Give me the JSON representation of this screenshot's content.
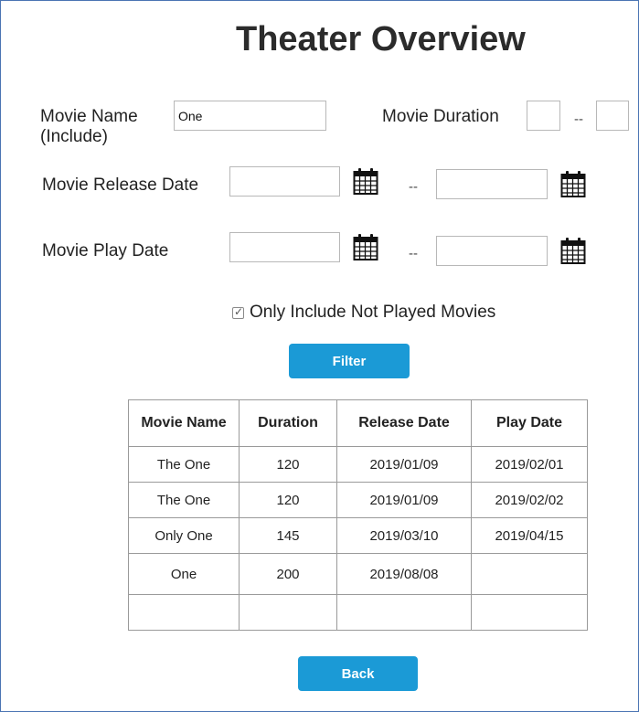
{
  "title": "Theater Overview",
  "filters": {
    "movie_name_label": "Movie Name\n(Include)",
    "movie_name_value": "One",
    "movie_duration_label": "Movie Duration",
    "duration_min": "",
    "duration_max": "",
    "release_date_label": "Movie Release Date",
    "release_from": "",
    "release_to": "",
    "play_date_label": "Movie Play Date",
    "play_from": "",
    "play_to": "",
    "range_dash_short": "--",
    "range_dash_long": "--",
    "only_not_played_label": "Only Include Not Played Movies",
    "only_not_played_checked": true
  },
  "buttons": {
    "filter": "Filter",
    "back": "Back"
  },
  "table": {
    "headers": [
      "Movie Name",
      "Duration",
      "Release Date",
      "Play Date"
    ],
    "rows": [
      [
        "The One",
        "120",
        "2019/01/09",
        "2019/02/01"
      ],
      [
        "The One",
        "120",
        "2019/01/09",
        "2019/02/02"
      ],
      [
        "Only One",
        "145",
        "2019/03/10",
        "2019/04/15"
      ],
      [
        "One",
        "200",
        "2019/08/08",
        ""
      ],
      [
        "",
        "",
        "",
        ""
      ]
    ]
  },
  "icons": {
    "calendar": "calendar-icon"
  },
  "colors": {
    "button": "#1b9ad6",
    "frame_border": "#4a74b3"
  }
}
